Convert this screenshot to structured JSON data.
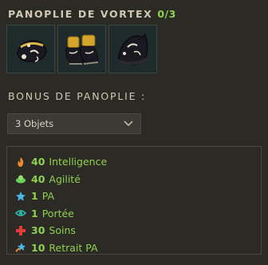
{
  "set": {
    "title": "PANOPLIE DE VORTEX",
    "count": "0/3",
    "items": [
      {
        "icon": "amulet-item-icon"
      },
      {
        "icon": "boots-item-icon"
      },
      {
        "icon": "hat-item-icon"
      }
    ]
  },
  "bonus": {
    "title": "BONUS DE PANOPLIE :",
    "select_value": "3 Objets",
    "stats": [
      {
        "value": "40",
        "label": "Intelligence",
        "icon": "fire-icon",
        "color": "#f08a2a"
      },
      {
        "value": "40",
        "label": "Agilité",
        "icon": "air-icon",
        "color": "#6bcf5a"
      },
      {
        "value": "1",
        "label": "PA",
        "icon": "star-icon",
        "color": "#49b8e6"
      },
      {
        "value": "1",
        "label": "Portée",
        "icon": "eye-icon",
        "color": "#2fb5a8"
      },
      {
        "value": "30",
        "label": "Soins",
        "icon": "heal-cross-icon",
        "color": "#e23b3b"
      },
      {
        "value": "10",
        "label": "Retrait PA",
        "icon": "star-withdraw-icon",
        "color": "#49b8e6"
      }
    ]
  },
  "colors": {
    "background": "#2b2a24",
    "bonus_text": "#8fd14f",
    "title_text": "#cfc8b5"
  }
}
